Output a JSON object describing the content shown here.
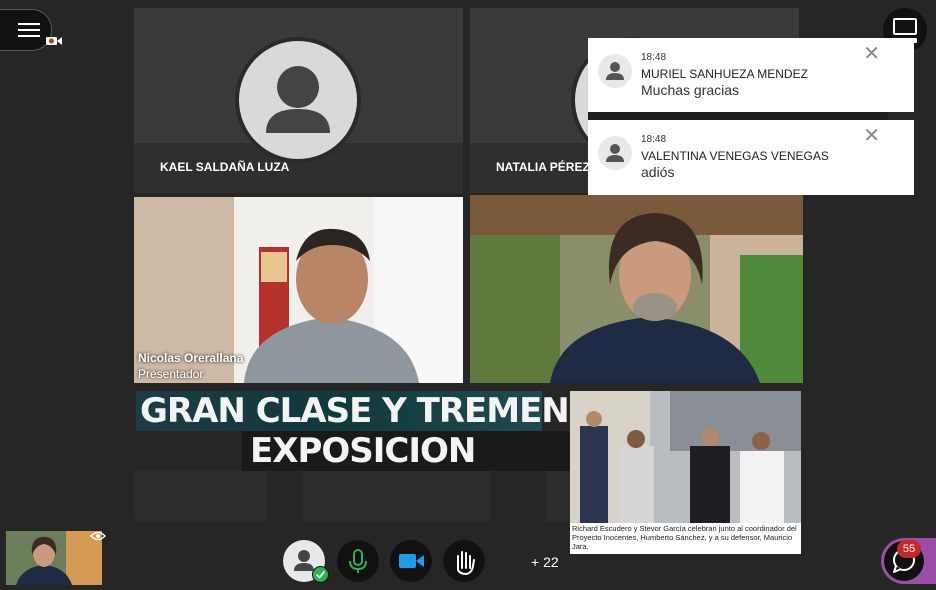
{
  "participants": [
    {
      "name": "KAEL SALDAÑA LUZA"
    },
    {
      "name": "NATALIA PÉREZ"
    }
  ],
  "presenter": {
    "name": "Nicolas Orerallana",
    "role": "Presentador"
  },
  "notifications": [
    {
      "time": "18:48",
      "sender": "MURIEL SANHUEZA MENDEZ",
      "message": "Muchas gracias"
    },
    {
      "time": "18:48",
      "sender": "VALENTINA VENEGAS VENEGAS",
      "message": "adiós"
    }
  ],
  "shared_content": {
    "banner_line1": "GRAN CLASE Y TREMENDA",
    "banner_line2": "EXPOSICION",
    "news_caption": "Richard Escudero y Stevor García celebran junto al coordinador del Proyecto Inocentes, Humberto Sánchez, y a su defensor, Mauricio Jara."
  },
  "controls": {
    "overflow_count": "+ 22",
    "chat_unread": "55"
  },
  "icons": [
    "hamburger-icon",
    "record-camera-icon",
    "layout-icon",
    "close-icon",
    "eye-icon",
    "mic-icon",
    "camera-icon",
    "hand-raise-icon",
    "chat-icon",
    "check-icon"
  ],
  "colors": {
    "accent_green": "#2bb24c",
    "camera_blue": "#1c9ee8",
    "chat_purple": "#9b4ea6",
    "badge_red": "#c62828"
  }
}
